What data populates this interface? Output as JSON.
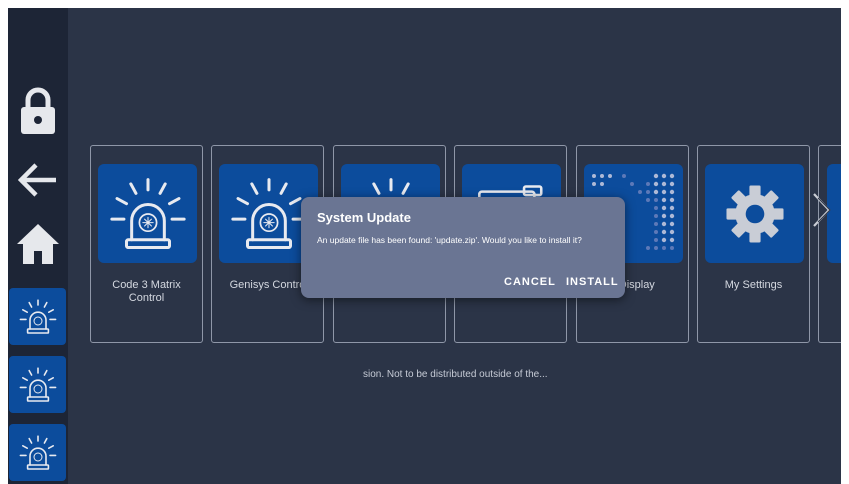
{
  "sidebar": {
    "icons": [
      "lock-icon",
      "back-arrow-icon",
      "home-icon",
      "beacon-icon",
      "beacon-icon",
      "beacon-icon"
    ]
  },
  "tiles": [
    {
      "label": "Code 3 Matrix Control",
      "icon": "beacon-icon"
    },
    {
      "label": "Genisys Contro",
      "icon": "beacon-icon"
    },
    {
      "label": "",
      "icon": "beacon-icon"
    },
    {
      "label": "",
      "icon": "display-icon"
    },
    {
      "label": "x Display",
      "icon": "matrix-display-icon"
    },
    {
      "label": "My Settings",
      "icon": "gear-icon"
    }
  ],
  "footer": {
    "text": "sion. Not to be distributed outside of the..."
  },
  "dialog": {
    "title": "System Update",
    "message": "An update file has been found: 'update.zip'. Would you like to install it?",
    "cancel_label": "CANCEL",
    "install_label": "INSTALL"
  },
  "colors": {
    "background": "#2b3447",
    "sidebar": "#1d2536",
    "tile_blue": "#0c4c9c",
    "dialog": "#6a7593"
  }
}
